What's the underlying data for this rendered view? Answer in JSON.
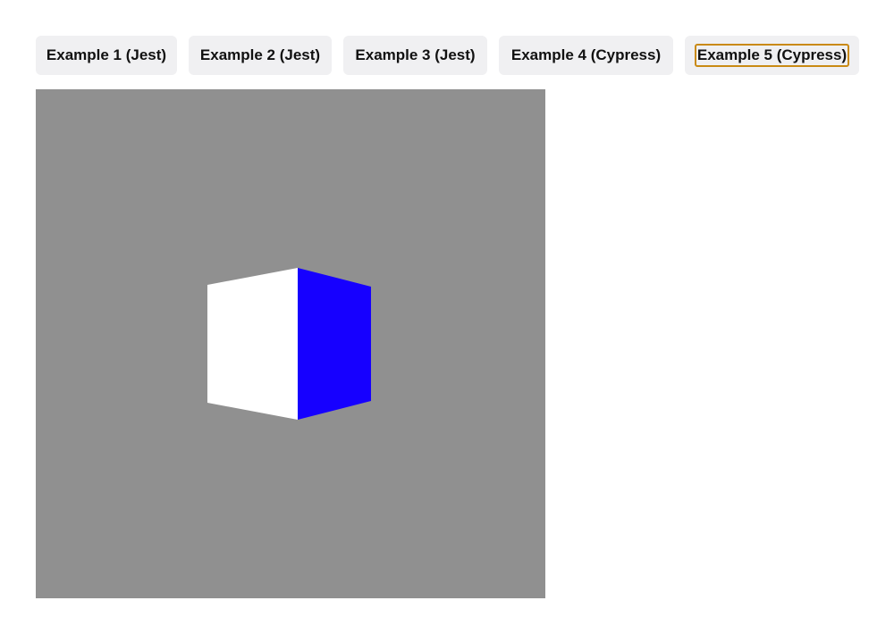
{
  "tabs": [
    {
      "label": "Example 1 (Jest)",
      "focused": false
    },
    {
      "label": "Example 2 (Jest)",
      "focused": false
    },
    {
      "label": "Example 3 (Jest)",
      "focused": false
    },
    {
      "label": "Example 4 (Cypress)",
      "focused": false
    },
    {
      "label": "Example 5 (Cypress)",
      "focused": true
    }
  ],
  "scene": {
    "background_color": "#909090",
    "cube": {
      "front_face_color": "#ffffff",
      "side_face_color": "#1600ff"
    }
  },
  "colors": {
    "focus_outline": "#c98a14",
    "tab_background": "#f0f0f2"
  }
}
